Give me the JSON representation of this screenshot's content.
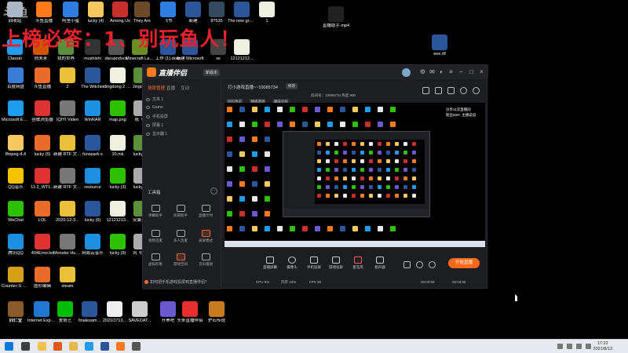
{
  "overlay_banner": "上榜必答：1、别玩鱼人！",
  "watermark": "斗鱼",
  "desktop_icons": [
    {
      "label": "回收站",
      "color": "#aab7c4"
    },
    {
      "label": "斗鱼直播",
      "color": "#ff7a1a"
    },
    {
      "label": "阿里小蜜",
      "color": "#2f7de1"
    },
    {
      "label": "lucky (4)",
      "color": "#f6c85f"
    },
    {
      "label": "Among Us",
      "color": "#c8302b"
    },
    {
      "label": "They Are",
      "color": "#6b4a2a"
    },
    {
      "label": "飞书",
      "color": "#2f7de1"
    },
    {
      "label": "新建",
      "color": "#2b579a"
    },
    {
      "label": "8?535",
      "color": "#34495e"
    },
    {
      "label": "The new green rev...",
      "color": "#2b579a"
    },
    {
      "label": "1",
      "color": "#f0f0e0"
    },
    {
      "label": "直播助手.mp4",
      "color": "#222222"
    },
    {
      "label": "Classin",
      "color": "#1f9cf0"
    },
    {
      "label": "向未来",
      "color": "#d35400"
    },
    {
      "label": "我的世界",
      "color": "#5a8f3b"
    },
    {
      "label": "mushishi",
      "color": "#333333"
    },
    {
      "label": "daruandocs",
      "color": "#555555"
    },
    {
      "label": "Minecraft Launcher",
      "color": "#6b8e23"
    },
    {
      "label": "工作 (1).docx",
      "color": "#2b579a"
    },
    {
      "label": "新建 Microsoft",
      "color": "#2b579a"
    },
    {
      "label": "ss",
      "color": "#444444"
    },
    {
      "label": "12121212...",
      "color": "#f0f0e0"
    },
    {
      "label": "eee.rtf",
      "color": "#2b579a"
    }
  ],
  "left_column_icons": [
    {
      "label": "百度网盘",
      "color": "#3a7bd5"
    },
    {
      "label": "Microsoft Edge",
      "color": "#1f9cf0"
    },
    {
      "label": "ffmpeg-4.4",
      "color": "#f6c85f"
    },
    {
      "label": "QQ音乐",
      "color": "#f5c400"
    },
    {
      "label": "WeChat",
      "color": "#2dc100"
    },
    {
      "label": "腾讯QQ",
      "color": "#1d8fe1"
    },
    {
      "label": "Counter-S Global Off...",
      "color": "#d4a017"
    },
    {
      "label": "同仁堂",
      "color": "#444444"
    }
  ],
  "app": {
    "name": "直播伴侣",
    "version": "新版本",
    "left_tabs": [
      "场景管理",
      "直播",
      "互动"
    ],
    "scenes": [
      "文本 1",
      "Game",
      "手机投屏",
      "屏幕 1",
      "显示器 1"
    ],
    "tools_label": "工具箱",
    "tools_more": "···",
    "tools": [
      "弹幕助手",
      "房管助手",
      "直播计时",
      "视频连麦",
      "多人连麦",
      "录屏模式",
      "虚拟形象",
      "游戏空间",
      "音乐播放"
    ],
    "notice": "如何把手机游戏投屏到直播伴侣？",
    "room_title": "打小游戏直播~~10085734",
    "room_edit": "修改",
    "tags": [
      "炉石传说",
      "网络游戏",
      "趣味竞技"
    ],
    "tag_meta": "房间号：10085734   热度 900",
    "preview_text": [
      "分享11次直播间",
      "粉丝500+  主播说说"
    ],
    "bottom_buttons": [
      "直播屏幕",
      "摄像头",
      "手机投屏",
      "游戏投屏",
      "麦克风",
      "扬声器"
    ],
    "start_live": "开始直播",
    "stats": [
      "CPU 5%",
      "内存 43%",
      "FPS 30",
      "00:03:59",
      "00:03:55"
    ]
  },
  "bottom_left_icons": [
    {
      "label": "同仁堂",
      "color": "#8b5a2b"
    },
    {
      "label": "Internet Explorer",
      "color": "#1f77d0"
    },
    {
      "label": "爱奇艺",
      "color": "#00be06"
    },
    {
      "label": "finalexam...",
      "color": "#2b579a"
    },
    {
      "label": "2021O713...",
      "color": "#eeeeee"
    },
    {
      "label": "SAVEDAT...",
      "color": "#cccccc"
    },
    {
      "label": "开黑吧",
      "color": "#6a5acd"
    },
    {
      "label": "头条直播伴侣",
      "color": "#e62e2e"
    },
    {
      "label": "炉石传说",
      "color": "#c77a1e"
    }
  ],
  "taskbar": {
    "time": "17:22",
    "date": "2021/8/13"
  }
}
